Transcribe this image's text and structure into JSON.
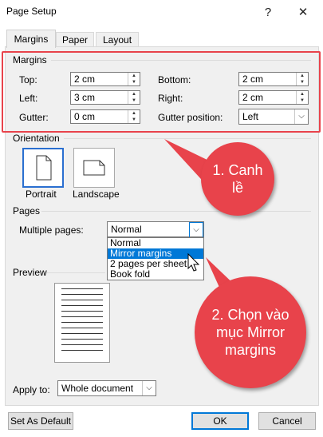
{
  "window": {
    "title": "Page Setup",
    "help_label": "?",
    "close_label": "✕"
  },
  "tabs": [
    {
      "label": "Margins"
    },
    {
      "label": "Paper"
    },
    {
      "label": "Layout"
    }
  ],
  "margins": {
    "heading": "Margins",
    "top_label": "Top:",
    "top_value": "2 cm",
    "left_label": "Left:",
    "left_value": "3 cm",
    "gutter_label": "Gutter:",
    "gutter_value": "0 cm",
    "bottom_label": "Bottom:",
    "bottom_value": "2 cm",
    "right_label": "Right:",
    "right_value": "2 cm",
    "gutter_pos_label": "Gutter position:",
    "gutter_pos_value": "Left"
  },
  "orientation": {
    "heading": "Orientation",
    "portrait_label": "Portrait",
    "landscape_label": "Landscape"
  },
  "pages": {
    "heading": "Pages",
    "multiple_label": "Multiple pages:",
    "multiple_value": "Normal",
    "options": [
      "Normal",
      "Mirror margins",
      "2 pages per sheet",
      "Book fold"
    ],
    "highlighted": "Mirror margins"
  },
  "preview": {
    "heading": "Preview"
  },
  "apply": {
    "label": "Apply to:",
    "value": "Whole document"
  },
  "buttons": {
    "default_label": "Set As Default",
    "ok_label": "OK",
    "cancel_label": "Cancel"
  },
  "callouts": {
    "one": "1. Canh lề",
    "two": "2. Chọn vào mục Mirror margins"
  },
  "colors": {
    "accent": "#0078d7",
    "callout": "#e8434b"
  }
}
